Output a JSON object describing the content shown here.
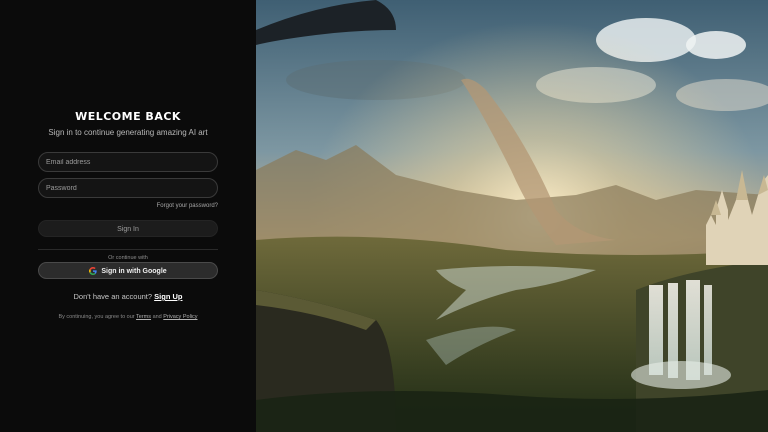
{
  "auth": {
    "title": "Welcome Back",
    "subtitle": "Sign in to continue generating amazing AI art",
    "email_placeholder": "Email address",
    "password_placeholder": "Password",
    "forgot_label": "Forgot your password?",
    "signin_label": "Sign In",
    "divider_label": "Or continue with",
    "google_label": "Sign in with Google",
    "no_account_label": "Don't have an account?",
    "signup_label": "Sign Up",
    "terms_prefix": "By continuing, you agree to our",
    "terms_label": "Terms",
    "terms_and": "and",
    "privacy_label": "Privacy Policy"
  },
  "colors": {
    "panel_bg": "#0b0b0b",
    "input_bg": "#141414",
    "google_btn_bg": "#2c2c2c"
  }
}
